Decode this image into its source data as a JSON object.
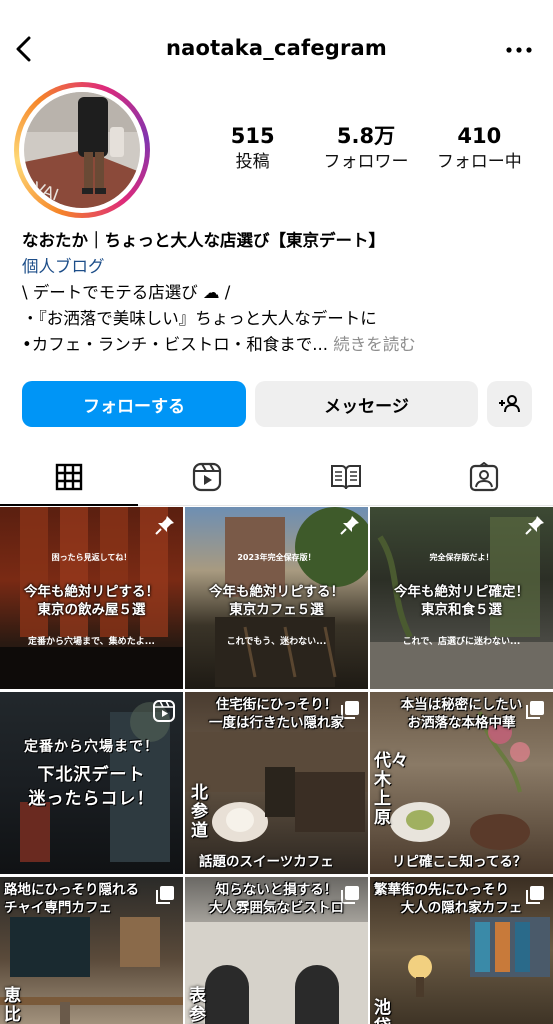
{
  "header": {
    "username": "naotaka_cafegram"
  },
  "profile": {
    "stats": [
      {
        "value": "515",
        "label": "投稿"
      },
      {
        "value": "5.8万",
        "label": "フォロワー"
      },
      {
        "value": "410",
        "label": "フォロー中"
      }
    ],
    "bio": {
      "name": "なおたか｜ちょっと大人な店選び【東京デート】",
      "category": "個人ブログ",
      "line1": "\\ デートでモテる店選び",
      "line1_end": " /",
      "line2": "・『お洒落で美味しい』ちょっと大人なデートに",
      "line3": "•カフェ・ランチ・ビストロ・和食まで...",
      "more": " 続きを読む"
    }
  },
  "actions": {
    "follow": "フォローする",
    "message": "メッセージ"
  },
  "posts": [
    {
      "small": "困ったら見返してね！",
      "title1": "今年も絶対リピする！",
      "title2": "東京の飲み屋５選",
      "sub": "定番から穴場まで、集めたよ..."
    },
    {
      "small": "2023年完全保存版！",
      "title1": "今年も絶対リピする！",
      "title2": "東京カフェ５選",
      "sub": "これでもう、迷わない..."
    },
    {
      "small": "完全保存版だよ！",
      "title1": "今年も絶対リピ確定！",
      "title2": "東京和食５選",
      "sub": "これで、店選びに迷わない..."
    },
    {
      "hand1": "定番から穴場まで！",
      "hand2": "下北沢デート",
      "hand3": "迷ったらコレ！"
    },
    {
      "top1": "住宅街にひっそり！",
      "top2": "一度は行きたい隠れ家",
      "vert": "北参道",
      "bottom": "話題のスイーツカフェ"
    },
    {
      "top1": "本当は秘密にしたい",
      "top2": "お洒落な本格中華",
      "vert": "代々木上原",
      "bottom": "リピ確ここ知ってる？"
    },
    {
      "top1": "路地にひっそり隠れる",
      "top2": "チャイ専門カフェ",
      "vert": "恵比寿"
    },
    {
      "top1": "知らないと損する！",
      "top2": "大人雰囲気なビストロ",
      "vert": "表参道"
    },
    {
      "top1": "繁華街の先にひっそり",
      "top2": "大人の隠れ家カフェ",
      "vert": "池袋"
    }
  ]
}
